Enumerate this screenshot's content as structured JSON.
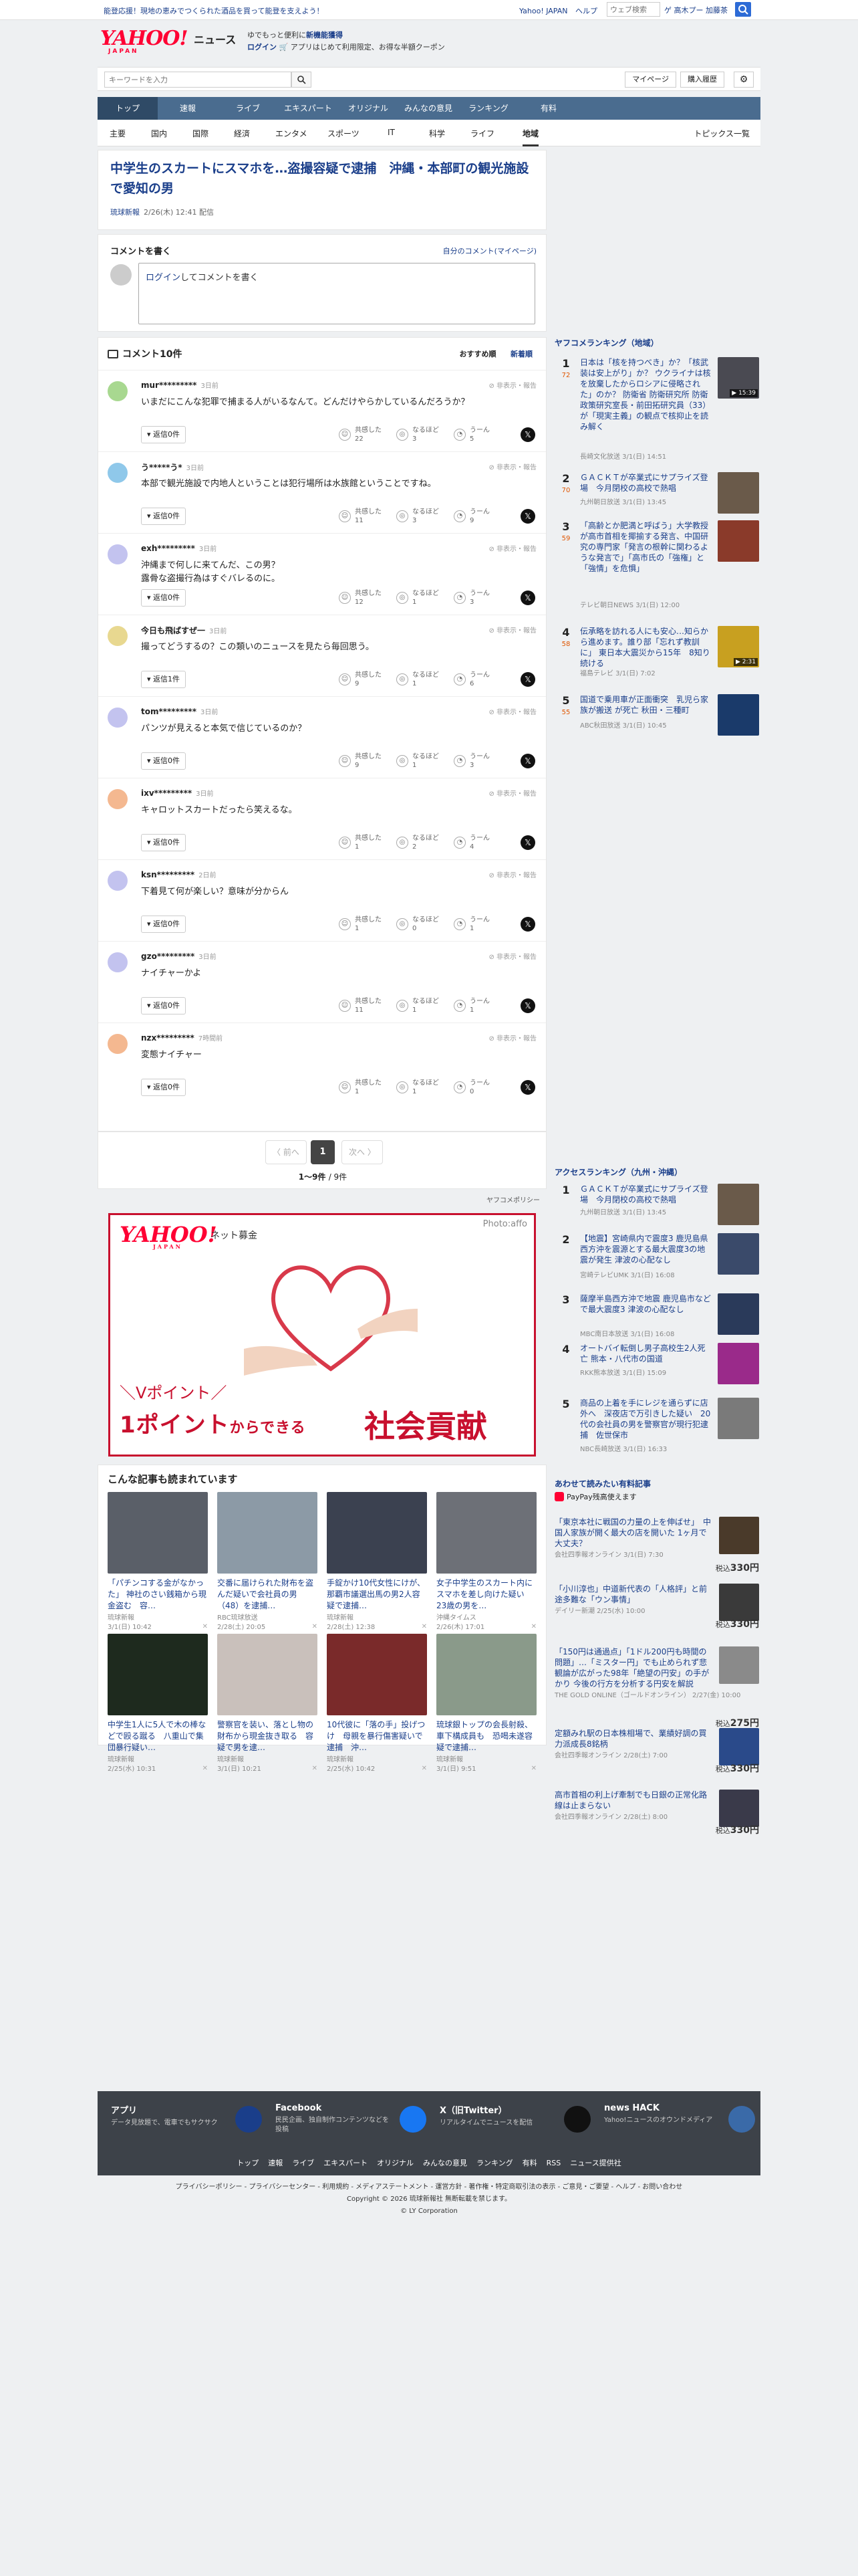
{
  "topstrip": {
    "promo": "能登応援！現地の恵みでつくられた酒品を買って能登を支えよう！",
    "links": [
      "Yahoo! JAPAN",
      "ヘルプ"
    ],
    "search_placeholder": "ウェブ検索",
    "user": "ゲ 高木プー 加藤茶"
  },
  "header": {
    "logo_main": "YAHOO!",
    "logo_sub": "JAPAN",
    "site": "ニュース",
    "msg_line1": "ゆでもっと便利に",
    "msg_line1_bold": "新機能獲得",
    "msg_login": "ログイン",
    "msg_line2": "🛒 アプリはじめて利用限定、お得な半額クーポン"
  },
  "search": {
    "placeholder": "キーワードを入力",
    "mypage": "マイページ",
    "purchase": "購入履歴"
  },
  "mainnav": [
    "トップ",
    "速報",
    "ライブ",
    "エキスパート",
    "オリジナル",
    "みんなの意見",
    "ランキング",
    "有料"
  ],
  "subnav": [
    "主要",
    "国内",
    "国際",
    "経済",
    "エンタメ",
    "スポーツ",
    "IT",
    "科学",
    "ライフ",
    "地域"
  ],
  "subnav_topics": "トピックス一覧",
  "article": {
    "title": "中学生のスカートにスマホを…盗撮容疑で逮捕　沖縄・本部町の観光施設で愛知の男",
    "source": "琉球新報",
    "date": "2/26(木) 12:41 配信"
  },
  "comment_write": {
    "title": "コメントを書く",
    "mine": "自分のコメント(マイページ)",
    "prompt_link": "ログイン",
    "prompt_rest": "してコメントを書く"
  },
  "comments": {
    "header": "コメント10件",
    "sort_recommended": "おすすめ順",
    "sort_new": "新着順",
    "report": "非表示・報告",
    "reply_label": "返信",
    "react_labels": [
      "共感した",
      "なるほど",
      "うーん"
    ],
    "items": [
      {
        "name": "mur*********",
        "time": "3日前",
        "body": "いまだにこんな犯罪で捕まる人がいるなんて。どんだけやらかしているんだろうか？",
        "replies": "0件",
        "counts": [
          "22",
          "3",
          "5"
        ],
        "color": "#a8d890"
      },
      {
        "name": "う*****う*",
        "time": "3日前",
        "body": "本部で観光施設で内地人ということは犯行場所は水族館ということですね。",
        "replies": "0件",
        "counts": [
          "11",
          "3",
          "9"
        ],
        "color": "#8fc8ea"
      },
      {
        "name": "exh*********",
        "time": "3日前",
        "body": "沖縄まで何しに来てんだ、この男？\n露骨な盗撮行為はすぐバレるのに。",
        "replies": "0件",
        "counts": [
          "12",
          "1",
          "3"
        ],
        "color": "#c3c3ef"
      },
      {
        "name": "今日も飛ばすぜ一",
        "time": "3日前",
        "body": "撮ってどうするの？この類いのニュースを見たら毎回思う。",
        "replies": "1件",
        "counts": [
          "9",
          "1",
          "6"
        ],
        "color": "#e8d890"
      },
      {
        "name": "tom*********",
        "time": "3日前",
        "body": "パンツが見えると本気で信じているのか？",
        "replies": "0件",
        "counts": [
          "9",
          "1",
          "3"
        ],
        "color": "#c3c3ef"
      },
      {
        "name": "ixv*********",
        "time": "3日前",
        "body": "キャロットスカートだったら笑えるな。",
        "replies": "0件",
        "counts": [
          "1",
          "2",
          "4"
        ],
        "color": "#f4b890"
      },
      {
        "name": "ksn*********",
        "time": "2日前",
        "body": "下着見て何が楽しい？意味が分からん",
        "replies": "0件",
        "counts": [
          "1",
          "0",
          "1"
        ],
        "color": "#c3c3ef"
      },
      {
        "name": "gzo*********",
        "time": "3日前",
        "body": "ナイチャーかよ",
        "replies": "0件",
        "counts": [
          "11",
          "1",
          "1"
        ],
        "color": "#c3c3ef"
      },
      {
        "name": "nzx*********",
        "time": "7時間前",
        "body": "変態ナイチャー",
        "replies": "0件",
        "counts": [
          "1",
          "1",
          "0"
        ],
        "color": "#f4b890"
      }
    ]
  },
  "pager": {
    "prev": "〈 前へ",
    "page": "1",
    "next": "次へ 〉",
    "range": "1〜9件",
    "total": "/ 9件"
  },
  "ad": {
    "policy": "ヤフコメポリシー",
    "brand": "YAHOO!",
    "brand_sub": "JAPAN",
    "service": "ネット募金",
    "credit": "Photo:affo",
    "tagline": "＼Vポイント／",
    "big1": "1ポイント",
    "big1_rest": "からできる",
    "big2": "社会貢献"
  },
  "related": {
    "title": "こんな記事も読まれています",
    "items": [
      {
        "title": "「パチンコする金がなかった」 神社のさい銭箱から現金盗む　容…",
        "source": "琉球新報",
        "date": "3/1(日) 10:42",
        "img": "#5a5f68"
      },
      {
        "title": "交番に届けられた財布を盗んだ疑いで会社員の男（48）を逮捕…",
        "source": "RBC琉球放送",
        "date": "2/28(土) 20:05",
        "img": "#8c9aa6"
      },
      {
        "title": "手錠かけ10代女性にけが、那覇市議選出馬の男2人容疑で逮捕…",
        "source": "琉球新報",
        "date": "2/28(土) 12:38",
        "img": "#3b4150"
      },
      {
        "title": "女子中学生のスカート内にスマホを差し向けた疑い　23歳の男を…",
        "source": "沖縄タイムス",
        "date": "2/26(木) 17:01",
        "img": "#6d7077"
      },
      {
        "title": "中学生1人に5人で木の棒などで殴る蹴る　八重山で集団暴行疑い…",
        "source": "琉球新報",
        "date": "2/25(水) 10:31",
        "img": "#1e2a1e"
      },
      {
        "title": "警察官を装い、落とし物の財布から現金抜き取る　容疑で男を逮…",
        "source": "琉球新報",
        "date": "3/1(日) 10:21",
        "img": "#c9c0bb"
      },
      {
        "title": "10代彼に「落の手」投げつけ　母親を暴行傷害疑いで逮捕　沖…",
        "source": "琉球新報",
        "date": "2/25(水) 10:42",
        "img": "#7a2a2a"
      },
      {
        "title": "琉球銀トップの会長射殺、車下構成員も　恐喝未遂容疑で逮捕…",
        "source": "琉球新報",
        "date": "3/1(日) 9:51",
        "img": "#8a9a8a"
      }
    ]
  },
  "side_ranking": {
    "title": "ヤフコメランキング（地域）",
    "items": [
      {
        "n": "1",
        "cm": "72",
        "title": "日本は「核を持つべき」か？「核武装は安上がり」か？ ウクライナは核を放棄したからロシアに侵略された」のか？ 防衛省 防衛研究所 防衛政策研究室長・前田拓研究員（33）が「現実主義」の観点で核抑止を読み解く",
        "source": "長崎文化放送 3/1(日) 14:51",
        "thumb": "#4a4a52",
        "badge": "▶ 15:39"
      },
      {
        "n": "2",
        "cm": "70",
        "title": "ＧＡＣＫＴが卒業式にサプライズ登場　今月閉校の高校で熱唱",
        "source": "九州朝日放送 3/1(日) 13:45",
        "thumb": "#6a5a4a",
        "badge": ""
      },
      {
        "n": "3",
        "cm": "59",
        "title": "「高齢とか肥満と呼ばう」大学教授が高市首相を揶揄する発言、中国研究の専門家「発言の根幹に関わるような発言で」「高市氏の「強権」と「強情」を危惧」",
        "source": "テレビ朝日NEWS 3/1(日) 12:00",
        "thumb": "#8a3a2a",
        "badge": ""
      },
      {
        "n": "4",
        "cm": "58",
        "title": "伝承略を訪れる人にも安心…知らから進めます。誰り部「忘れず教訓に」 東日本大震災から15年　8知り続ける",
        "source": "福島テレビ 3/1(日) 7:02",
        "thumb": "#c8a020",
        "badge": "▶ 2:31"
      },
      {
        "n": "5",
        "cm": "55",
        "title": "国道で乗用車が正面衝突　乳児ら家族が搬送 が死亡 秋田・三種町",
        "source": "ABC秋田放送 3/1(日) 10:45",
        "thumb": "#1a3a6a",
        "badge": ""
      }
    ]
  },
  "side_access": {
    "title": "アクセスランキング（九州・沖縄）",
    "items": [
      {
        "n": "1",
        "title": "ＧＡＣＫＴが卒業式にサプライズ登場　今月閉校の高校で熱唱",
        "source": "九州朝日放送 3/1(日) 13:45",
        "thumb": "#6a5a4a"
      },
      {
        "n": "2",
        "title": "【地震】宮崎県内で震度3 鹿児島県西方沖を震源とする最大震度3の地震が発生 津波の心配なし",
        "source": "宮崎テレビUMK 3/1(日) 16:08",
        "thumb": "#3a4a6a"
      },
      {
        "n": "3",
        "title": "薩摩半島西方沖で地震 鹿児島市などで最大震度3 津波の心配なし",
        "source": "MBC南日本放送 3/1(日) 16:08",
        "thumb": "#2a3a5a"
      },
      {
        "n": "4",
        "title": "オートバイ転倒し男子高校生2人死亡 熊本・八代市の国道",
        "source": "RKK熊本放送 3/1(日) 15:09",
        "thumb": "#9a2a8a"
      },
      {
        "n": "5",
        "title": "商品の上着を手にレジを通らずに店外へ　深夜店で万引きした疑い　20代の会社員の男を警察官が現行犯逮捕　佐世保市",
        "source": "NBC長崎放送 3/1(日) 16:33",
        "thumb": "#7a7a7a"
      }
    ]
  },
  "side_paid": {
    "title": "あわせて読みたい有料記事",
    "badge": "PayPay残高使えます",
    "price_label": "税込",
    "items": [
      {
        "title": "「東京本社に戦国の力量の上を伸ばせ」　中国人家族が開く最大の店を開いた 1ヶ月で大丈夫？",
        "source": "会社四季報オンライン 3/1(日) 7:30",
        "price": "330円",
        "thumb": "#4a3a2a"
      },
      {
        "title": "「小川淳也」中道新代表の「人格評」と前途多難な「ウン事情」",
        "source": "デイリー新潮 2/25(水) 10:00",
        "price": "330円",
        "thumb": "#3a3a3a"
      },
      {
        "title": "「150円は通過点」「1ドル200円も時間の問題」…「ミスター円」でも止められず悲観論が広がった98年「絶望の円安」の手がかり 今後の行方を分析する円安を解説",
        "source": "THE GOLD ONLINE（ゴールドオンライン） 2/27(金) 10:00",
        "price": "275円",
        "thumb": "#8a8a8a"
      },
      {
        "title": "定額みれ駅の日本株相場で、業績好調の買力派成長8銘柄",
        "source": "会社四季報オンライン 2/28(土) 7:00",
        "price": "330円",
        "thumb": "#2a4a8a"
      },
      {
        "title": "高市首相の利上げ牽制でも日銀の正常化路線は止まらない",
        "source": "会社四季報オンライン 2/28(土) 8:00",
        "price": "330円",
        "thumb": "#3a3a4a"
      }
    ]
  },
  "footer": {
    "cols": [
      {
        "h": "アプリ",
        "d": "データ見放題で、電車でもサクサク",
        "icon": "#1a3e8a"
      },
      {
        "h": "Facebook",
        "d": "民民企画、独自制作コンテンツなどを投稿",
        "icon": "#1877f2"
      },
      {
        "h": "X（旧Twitter）",
        "d": "リアルタイムでニュースを配信",
        "icon": "#111111"
      },
      {
        "h": "news HACK",
        "d": "Yahoo!ニュースのオウンドメディア",
        "icon": "#3a6aa8"
      }
    ],
    "nav": [
      "トップ",
      "速報",
      "ライブ",
      "エキスパート",
      "オリジナル",
      "みんなの意見",
      "ランキング",
      "有料",
      "RSS",
      "ニュース提供社"
    ],
    "links": "プライバシーポリシー - プライバシーセンター - 利用規約 - メディアステートメント - 運営方針 - 著作権・特定商取引法の表示 - ご意見・ご要望 - ヘルプ - お問い合わせ",
    "copyright": "Copyright © 2026 琉球新報社 無断転載を禁じます。",
    "corp": "© LY Corporation"
  }
}
